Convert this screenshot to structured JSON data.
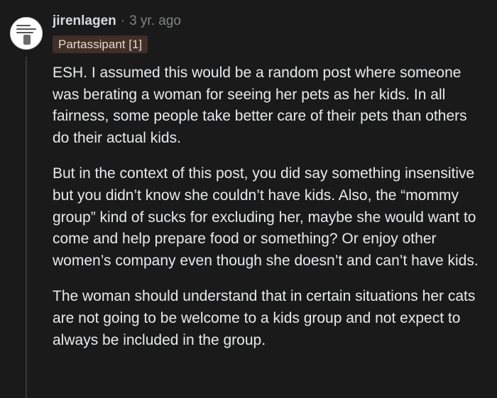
{
  "comment": {
    "username": "jirenlagen",
    "separator": "·",
    "timestamp": "3 yr. ago",
    "flair": "Partassipant [1]",
    "paragraphs": [
      "ESH. I assumed this would be a random post where someone was berating a woman for seeing her pets as her kids. In all fairness, some people take better care of their pets than others do their actual kids.",
      "But in the context of this post, you did say something insensitive but you didn’t know she couldn’t have kids. Also, the “mommy group” kind of sucks for excluding her, maybe she would want to come and help prepare food or something? Or enjoy other women’s company even though she doesn’t and can’t have kids.",
      "The woman should understand that in certain situations her cats are not going to be welcome to a kids group and not expect to always be included in the group."
    ]
  }
}
